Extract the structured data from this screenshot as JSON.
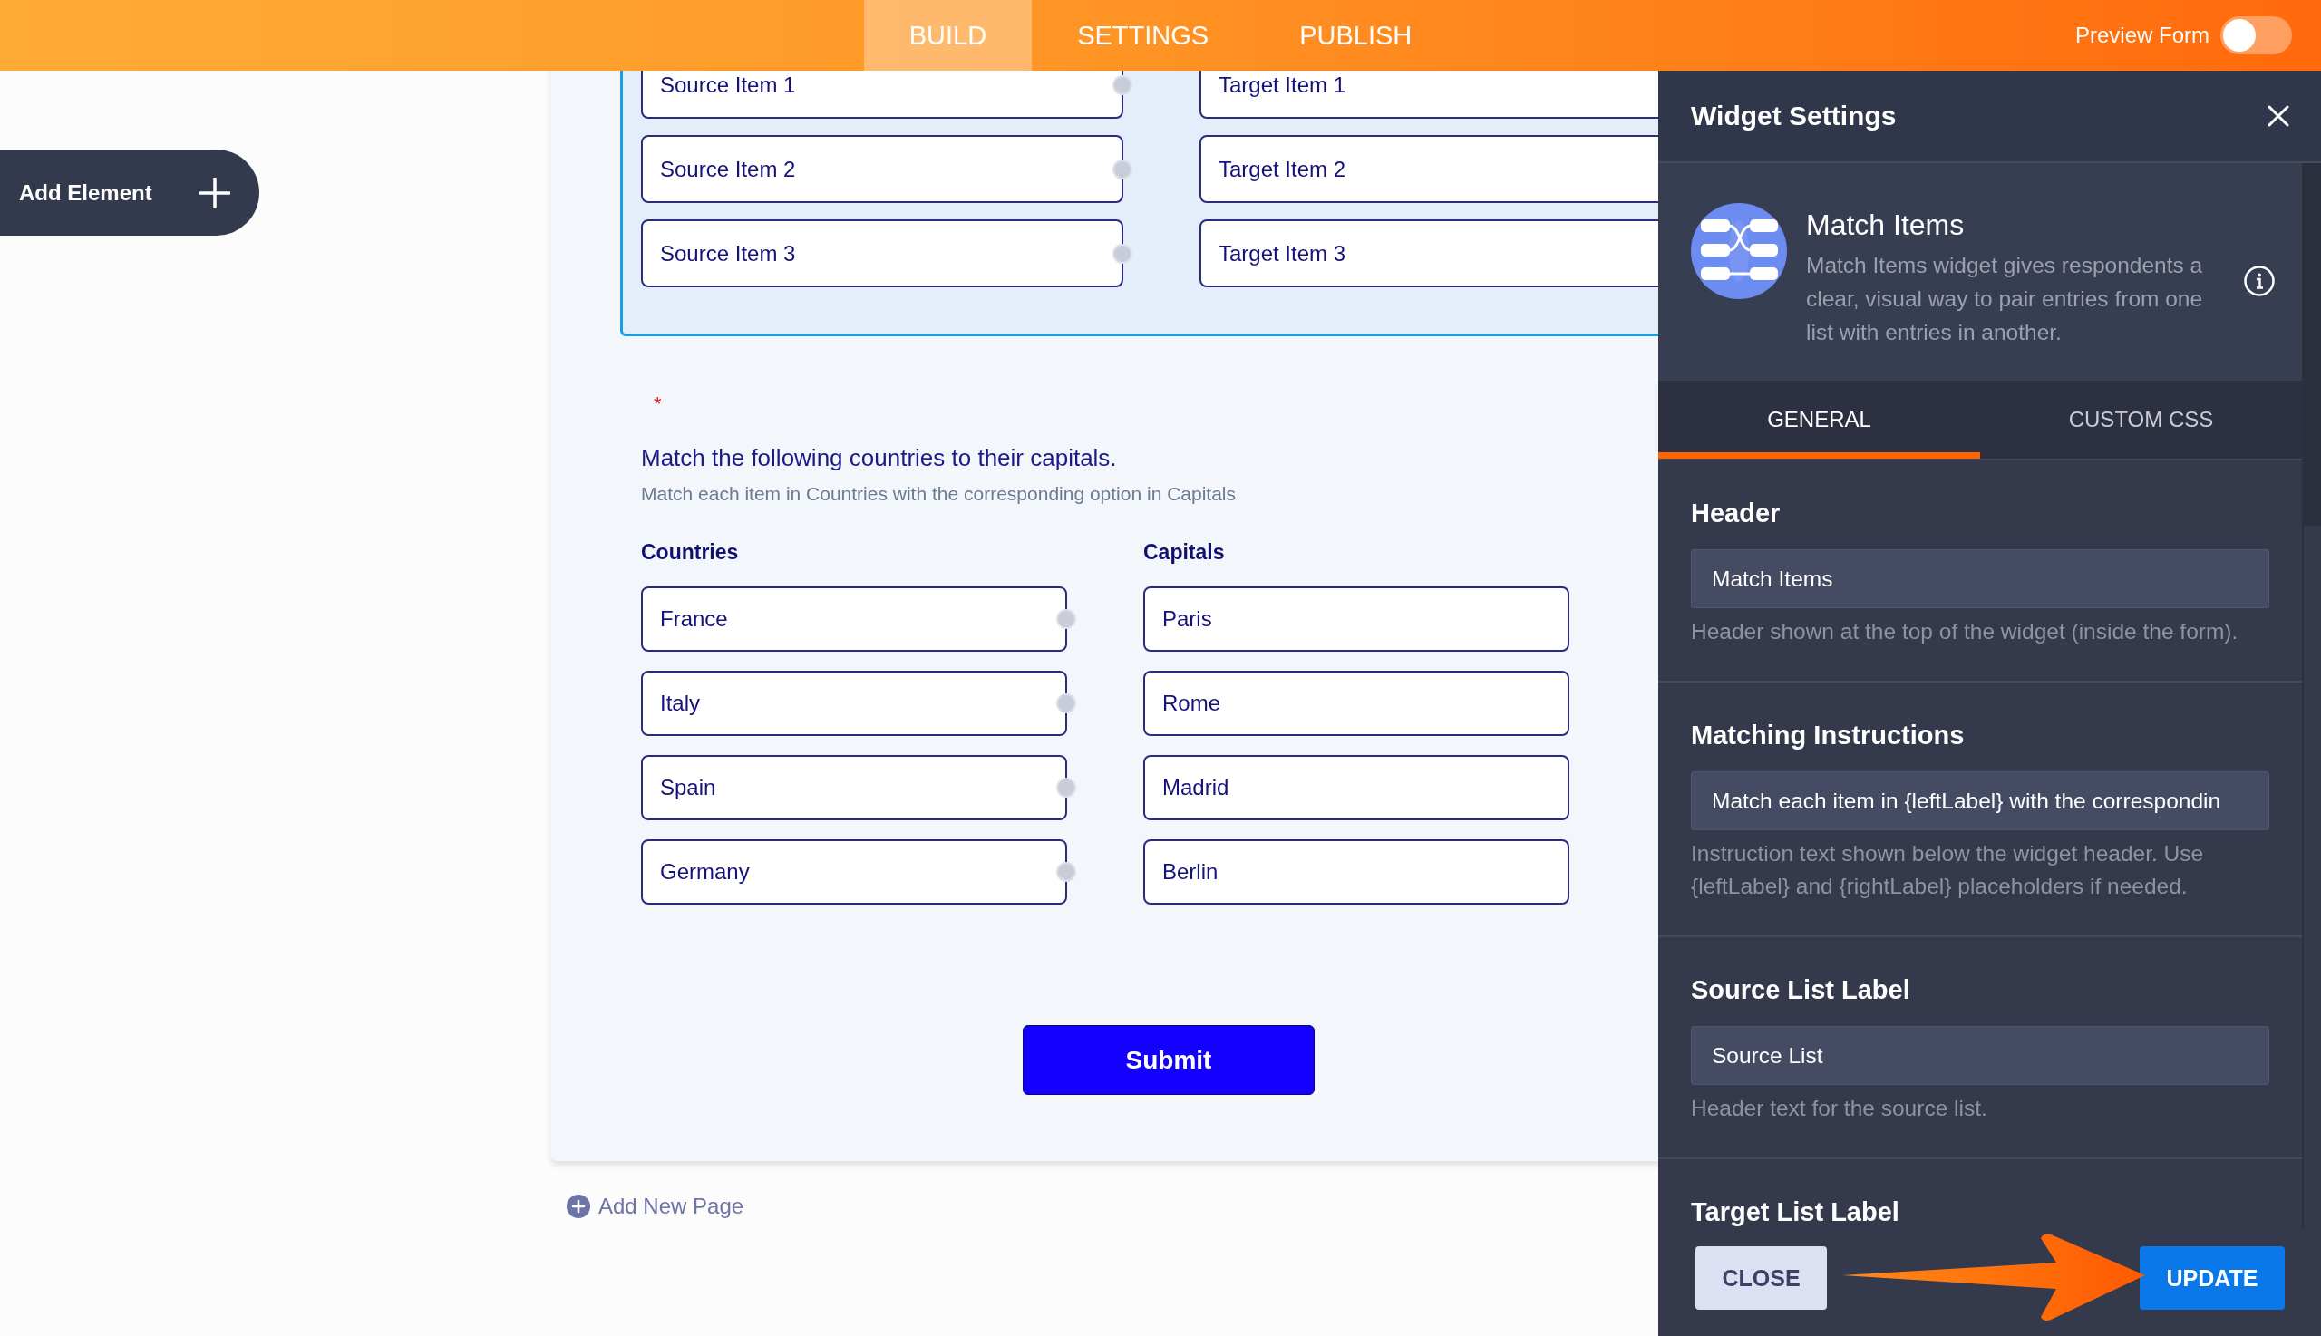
{
  "top_bar": {
    "tabs": [
      {
        "label": "BUILD",
        "selected": true
      },
      {
        "label": "SETTINGS",
        "selected": false
      },
      {
        "label": "PUBLISH",
        "selected": false
      }
    ],
    "preview_toggle": {
      "label": "Preview Form",
      "on": false
    }
  },
  "add_element": {
    "label": "Add Element"
  },
  "form": {
    "widgets": [
      {
        "selected": true,
        "pairs": [
          {
            "source": "Source Item 1",
            "target": "Target Item 1"
          },
          {
            "source": "Source Item 2",
            "target": "Target Item 2"
          },
          {
            "source": "Source Item 3",
            "target": "Target Item 3"
          }
        ]
      },
      {
        "selected": false,
        "required_mark": "*",
        "question": "Match the following countries to their capitals.",
        "instructions": "Match each item in Countries with the corresponding option in Capitals",
        "source_label": "Countries",
        "target_label": "Capitals",
        "pairs": [
          {
            "source": "France",
            "target": "Paris"
          },
          {
            "source": "Italy",
            "target": "Rome"
          },
          {
            "source": "Spain",
            "target": "Madrid"
          },
          {
            "source": "Germany",
            "target": "Berlin"
          }
        ]
      }
    ],
    "submit": "Submit"
  },
  "add_page": "Add New Page",
  "widget_settings": {
    "title": "Widget Settings",
    "widget": {
      "name": "Match Items",
      "description": "Match Items widget gives respondents a clear, visual way to pair entries from one list with entries in another."
    },
    "tabs": [
      {
        "label": "GENERAL",
        "selected": true
      },
      {
        "label": "CUSTOM CSS",
        "selected": false
      }
    ],
    "fields": [
      {
        "label": "Header",
        "value": "Match Items",
        "help": "Header shown at the top of the widget (inside the form)."
      },
      {
        "label": "Matching Instructions",
        "value": "Match each item in {leftLabel} with the correspondin",
        "help": "Instruction text shown below the widget header. Use {leftLabel} and {rightLabel} placeholders if needed."
      },
      {
        "label": "Source List Label",
        "value": "Source List",
        "help": "Header text for the source list."
      },
      {
        "label": "Target List Label"
      }
    ],
    "buttons": [
      {
        "label": "CLOSE",
        "kind": "secondary"
      },
      {
        "label": "UPDATE",
        "kind": "primary"
      }
    ]
  }
}
